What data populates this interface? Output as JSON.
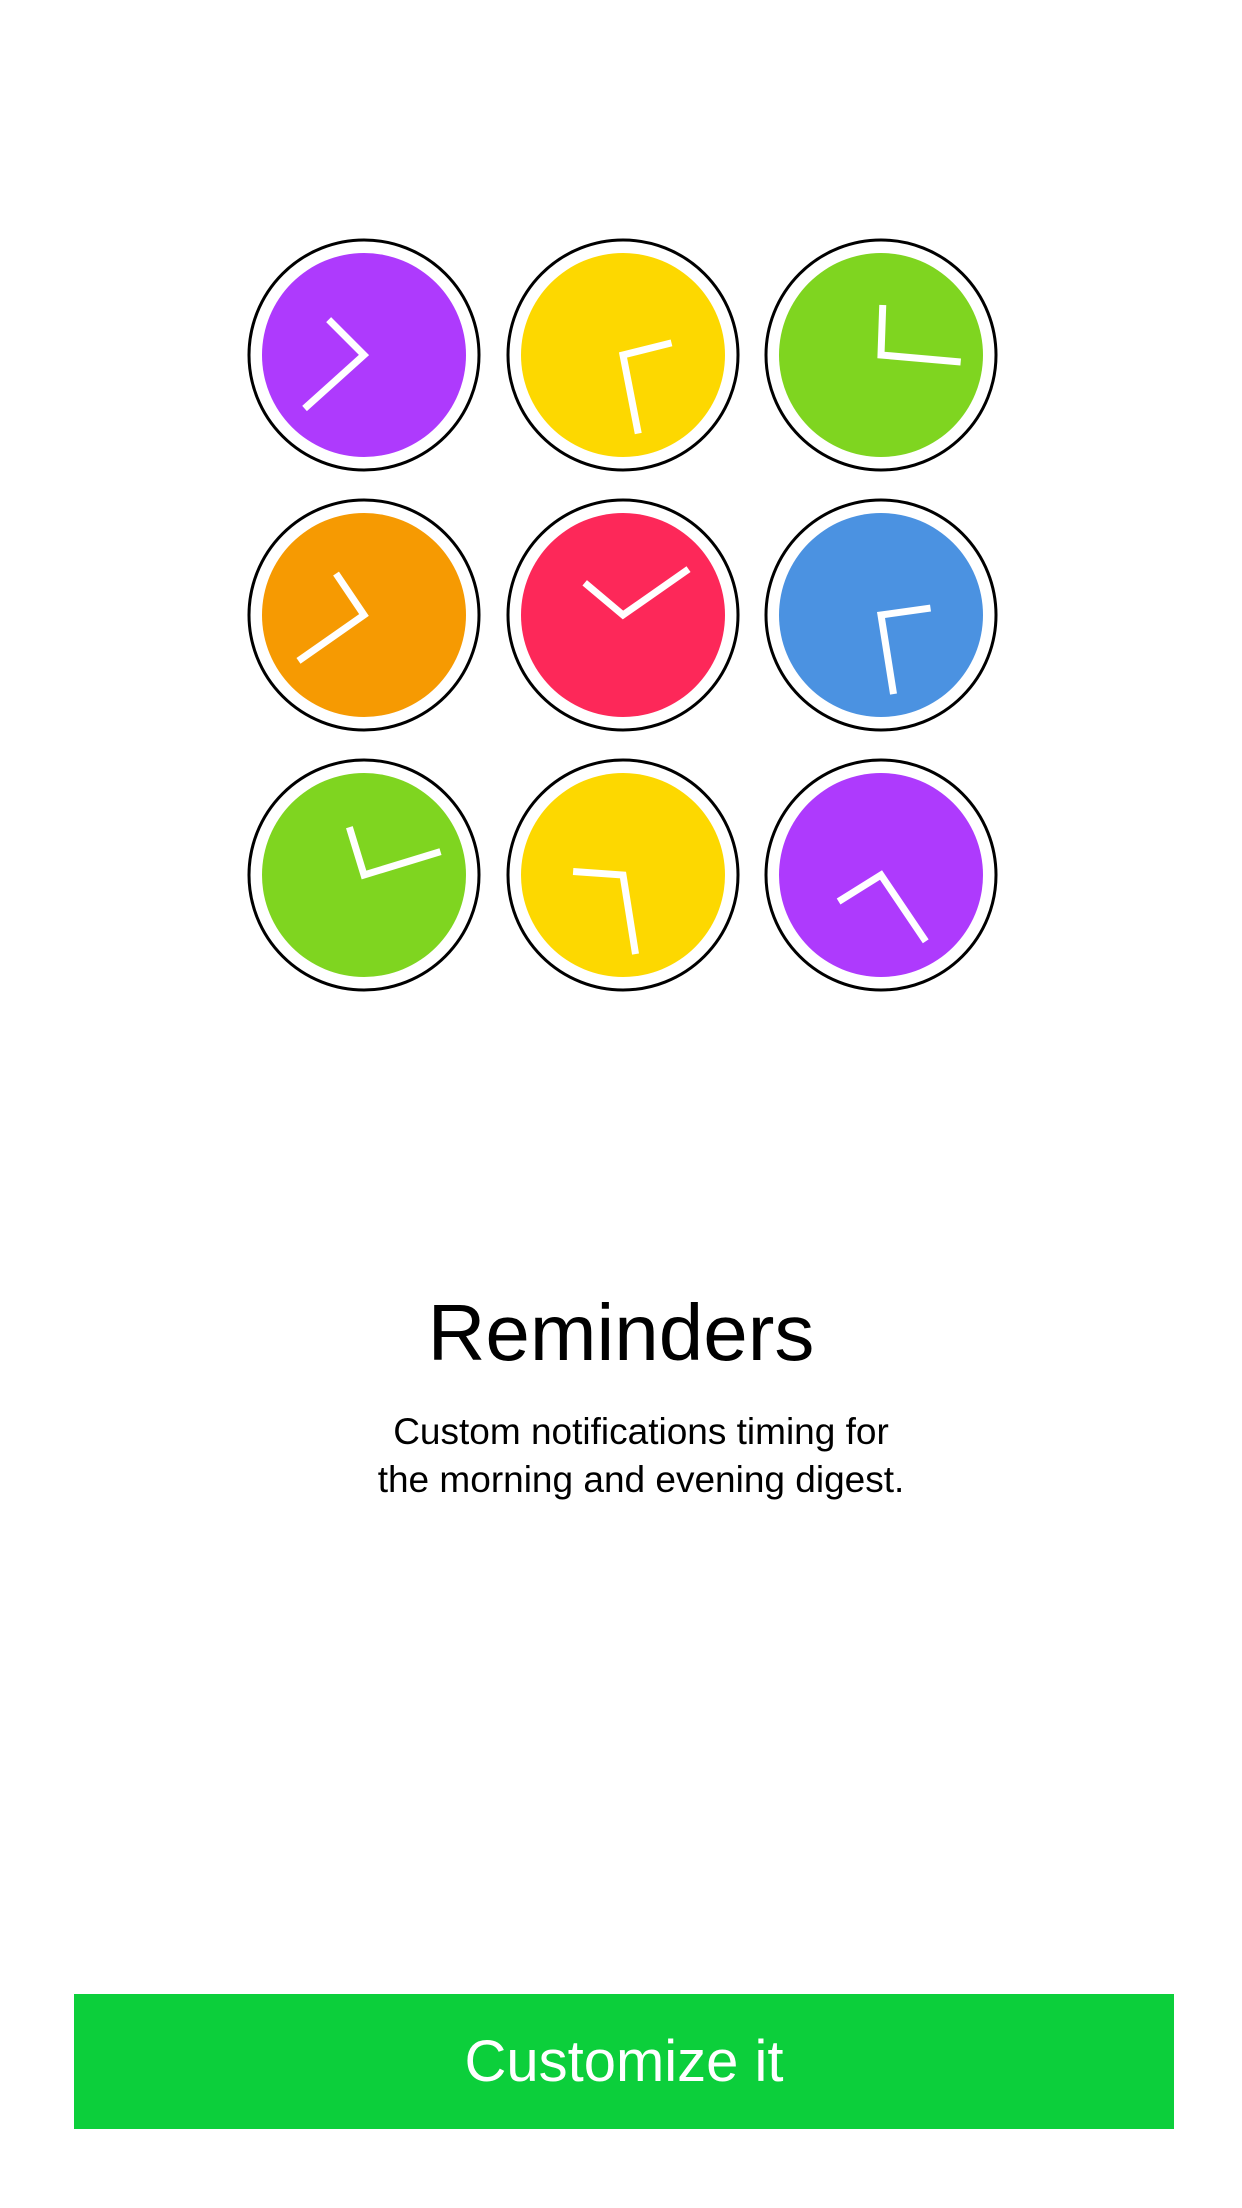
{
  "onboarding": {
    "title": "Reminders",
    "subtitle_line1": "Custom notifications timing for",
    "subtitle_line2": "the morning and evening digest.",
    "cta_label": "Customize it"
  },
  "colors": {
    "purple": "#ae3afd",
    "yellow": "#fdd800",
    "green": "#7fd520",
    "orange": "#f69a02",
    "red": "#fd2859",
    "blue": "#4b92e1",
    "button": "#0ccf3b"
  },
  "clocks": [
    {
      "name": "clock-purple-icon",
      "color": "purple",
      "hour_angle": 315,
      "minute_angle": 228
    },
    {
      "name": "clock-yellow-icon",
      "color": "yellow",
      "hour_angle": 76,
      "minute_angle": 169
    },
    {
      "name": "clock-green-icon",
      "color": "green",
      "hour_angle": 2,
      "minute_angle": 95
    },
    {
      "name": "clock-orange-icon",
      "color": "orange",
      "hour_angle": 326,
      "minute_angle": 235
    },
    {
      "name": "clock-red-icon",
      "color": "red",
      "hour_angle": 310,
      "minute_angle": 55
    },
    {
      "name": "clock-blue-icon",
      "color": "blue",
      "hour_angle": 82,
      "minute_angle": 171
    },
    {
      "name": "clock-green-icon",
      "color": "green",
      "hour_angle": 343,
      "minute_angle": 73
    },
    {
      "name": "clock-yellow-icon",
      "color": "yellow",
      "hour_angle": 274,
      "minute_angle": 171
    },
    {
      "name": "clock-purple-icon",
      "color": "purple",
      "hour_angle": 238,
      "minute_angle": 146
    }
  ]
}
